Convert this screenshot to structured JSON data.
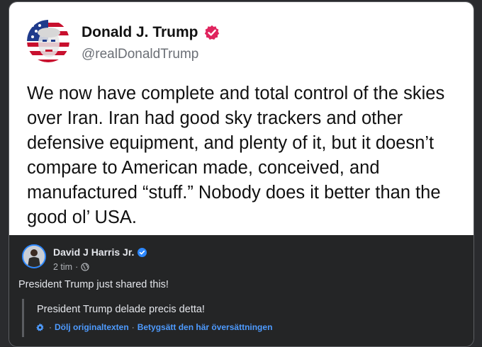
{
  "post": {
    "display_name": "Donald J. Trump",
    "handle": "@realDonaldTrump",
    "text": "We now have complete and total control of the skies over Iran. Iran had good sky trackers and other defensive equipment, and plenty of it, but it doesn’t compare to American made, conceived, and manufactured “stuff.” Nobody does it better than the good ol’ USA."
  },
  "fb": {
    "author": "David J Harris Jr.",
    "time": "2 tim",
    "meta_separator": "·",
    "text": "President Trump just shared this!",
    "translation": "President Trump delade precis detta!",
    "hide_original": "Dölj originaltexten",
    "rate_translation": "Betygsätt den här översättningen",
    "link_separator": "·"
  },
  "colors": {
    "verified_main": "#e0245e",
    "verified_fb": "#2d88ff",
    "link": "#4e9bff"
  }
}
